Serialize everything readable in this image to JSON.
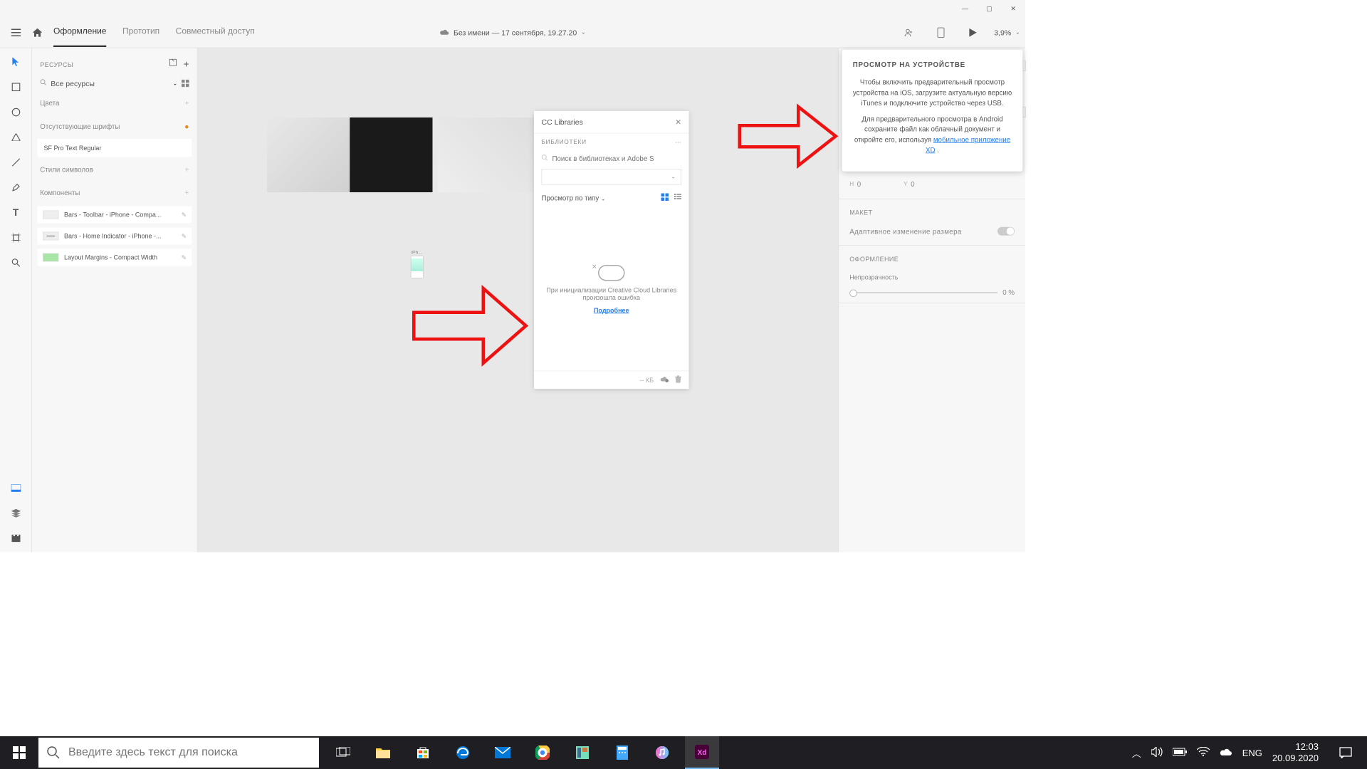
{
  "titlebar": {
    "min": "—",
    "max": "▢",
    "close": "✕"
  },
  "toolbar": {
    "tabs": [
      "Оформление",
      "Прототип",
      "Совместный доступ"
    ],
    "doc_title": "Без имени — 17 сентября, 19.27.20",
    "zoom": "3,9%"
  },
  "assets": {
    "title": "РЕСУРСЫ",
    "search": "Все ресурсы",
    "colors": "Цвета",
    "missing_fonts": "Отсутствующие шрифты",
    "font1": "SF Pro Text Regular",
    "styles": "Стили символов",
    "components": "Компоненты",
    "comp1": "Bars - Toolbar - iPhone - Compa...",
    "comp2": "Bars - Home Indicator - iPhone -...",
    "comp3": "Layout Margins - Compact Width"
  },
  "cc": {
    "title": "CC Libraries",
    "subtitle": "БИБЛИОТЕКИ",
    "search_ph": "Поиск в библиотеках и Adobe S",
    "viewby": "Просмотр по типу",
    "error": "При инициализации Creative Cloud Libraries произошла ошибка",
    "learn": "Подробнее",
    "size": "-- КБ"
  },
  "inspector": {
    "h_lbl": "H",
    "h_val": "0",
    "y_lbl": "Y",
    "y_val": "0",
    "layout": "МАКЕТ",
    "responsive": "Адаптивное изменение размера",
    "appearance": "ОФОРМЛЕНИЕ",
    "opacity_lbl": "Непрозрачность",
    "opacity_val": "0 %"
  },
  "popup": {
    "title": "ПРОСМОТР НА УСТРОЙСТВЕ",
    "p1": "Чтобы включить предварительный просмотр устройства на iOS, загрузите актуальную версию iTunes и подключите устройство через USB.",
    "p2a": "Для предварительного просмотра в Android сохраните файл как облачный документ и откройте его, используя ",
    "p2_link": "мобильное приложение XD",
    "p2b": " ."
  },
  "taskbar": {
    "search_ph": "Введите здесь текст для поиска",
    "lang": "ENG",
    "time": "12:03",
    "date": "20.09.2020"
  }
}
